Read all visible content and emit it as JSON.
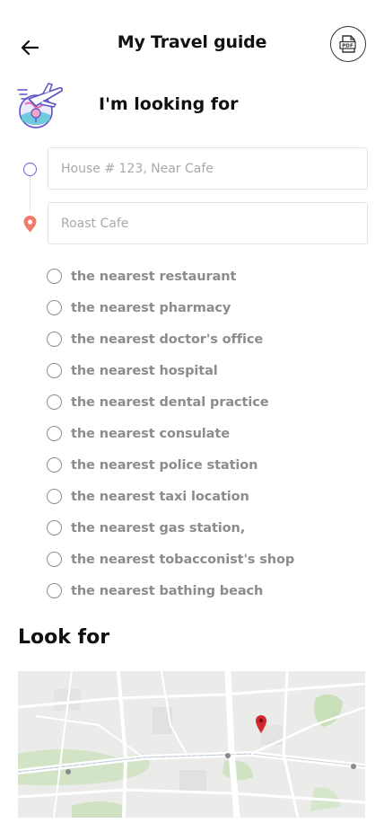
{
  "header": {
    "title": "My Travel guide",
    "back_icon": "arrow-left-icon",
    "pdf_label": "PDF"
  },
  "hero": {
    "title": "I'm looking for",
    "icon": "airplane-globe-icon"
  },
  "route": {
    "from": {
      "value": "",
      "placeholder": "House # 123, Near Cafe"
    },
    "to": {
      "value": "",
      "placeholder": "Roast Cafe"
    }
  },
  "options": [
    {
      "label": "the nearest restaurant",
      "checked": false
    },
    {
      "label": "the nearest pharmacy",
      "checked": false
    },
    {
      "label": "the nearest doctor's office",
      "checked": false
    },
    {
      "label": "the nearest hospital",
      "checked": false
    },
    {
      "label": "the nearest dental practice",
      "checked": false
    },
    {
      "label": "the nearest consulate",
      "checked": false
    },
    {
      "label": "the nearest police station",
      "checked": false
    },
    {
      "label": "the nearest taxi location",
      "checked": false
    },
    {
      "label": "the nearest gas station,",
      "checked": false
    },
    {
      "label": "the nearest tobacconist's shop",
      "checked": false
    },
    {
      "label": "the nearest bathing beach",
      "checked": false
    }
  ],
  "look_for": {
    "title": "Look for",
    "map_pin_icon": "map-pin-icon"
  },
  "colors": {
    "accent": "#6a5fd6",
    "pin": "#f27a6a",
    "map_pin": "#d0282e",
    "text_muted": "#8c8c8c",
    "placeholder": "#a9a9a9"
  }
}
